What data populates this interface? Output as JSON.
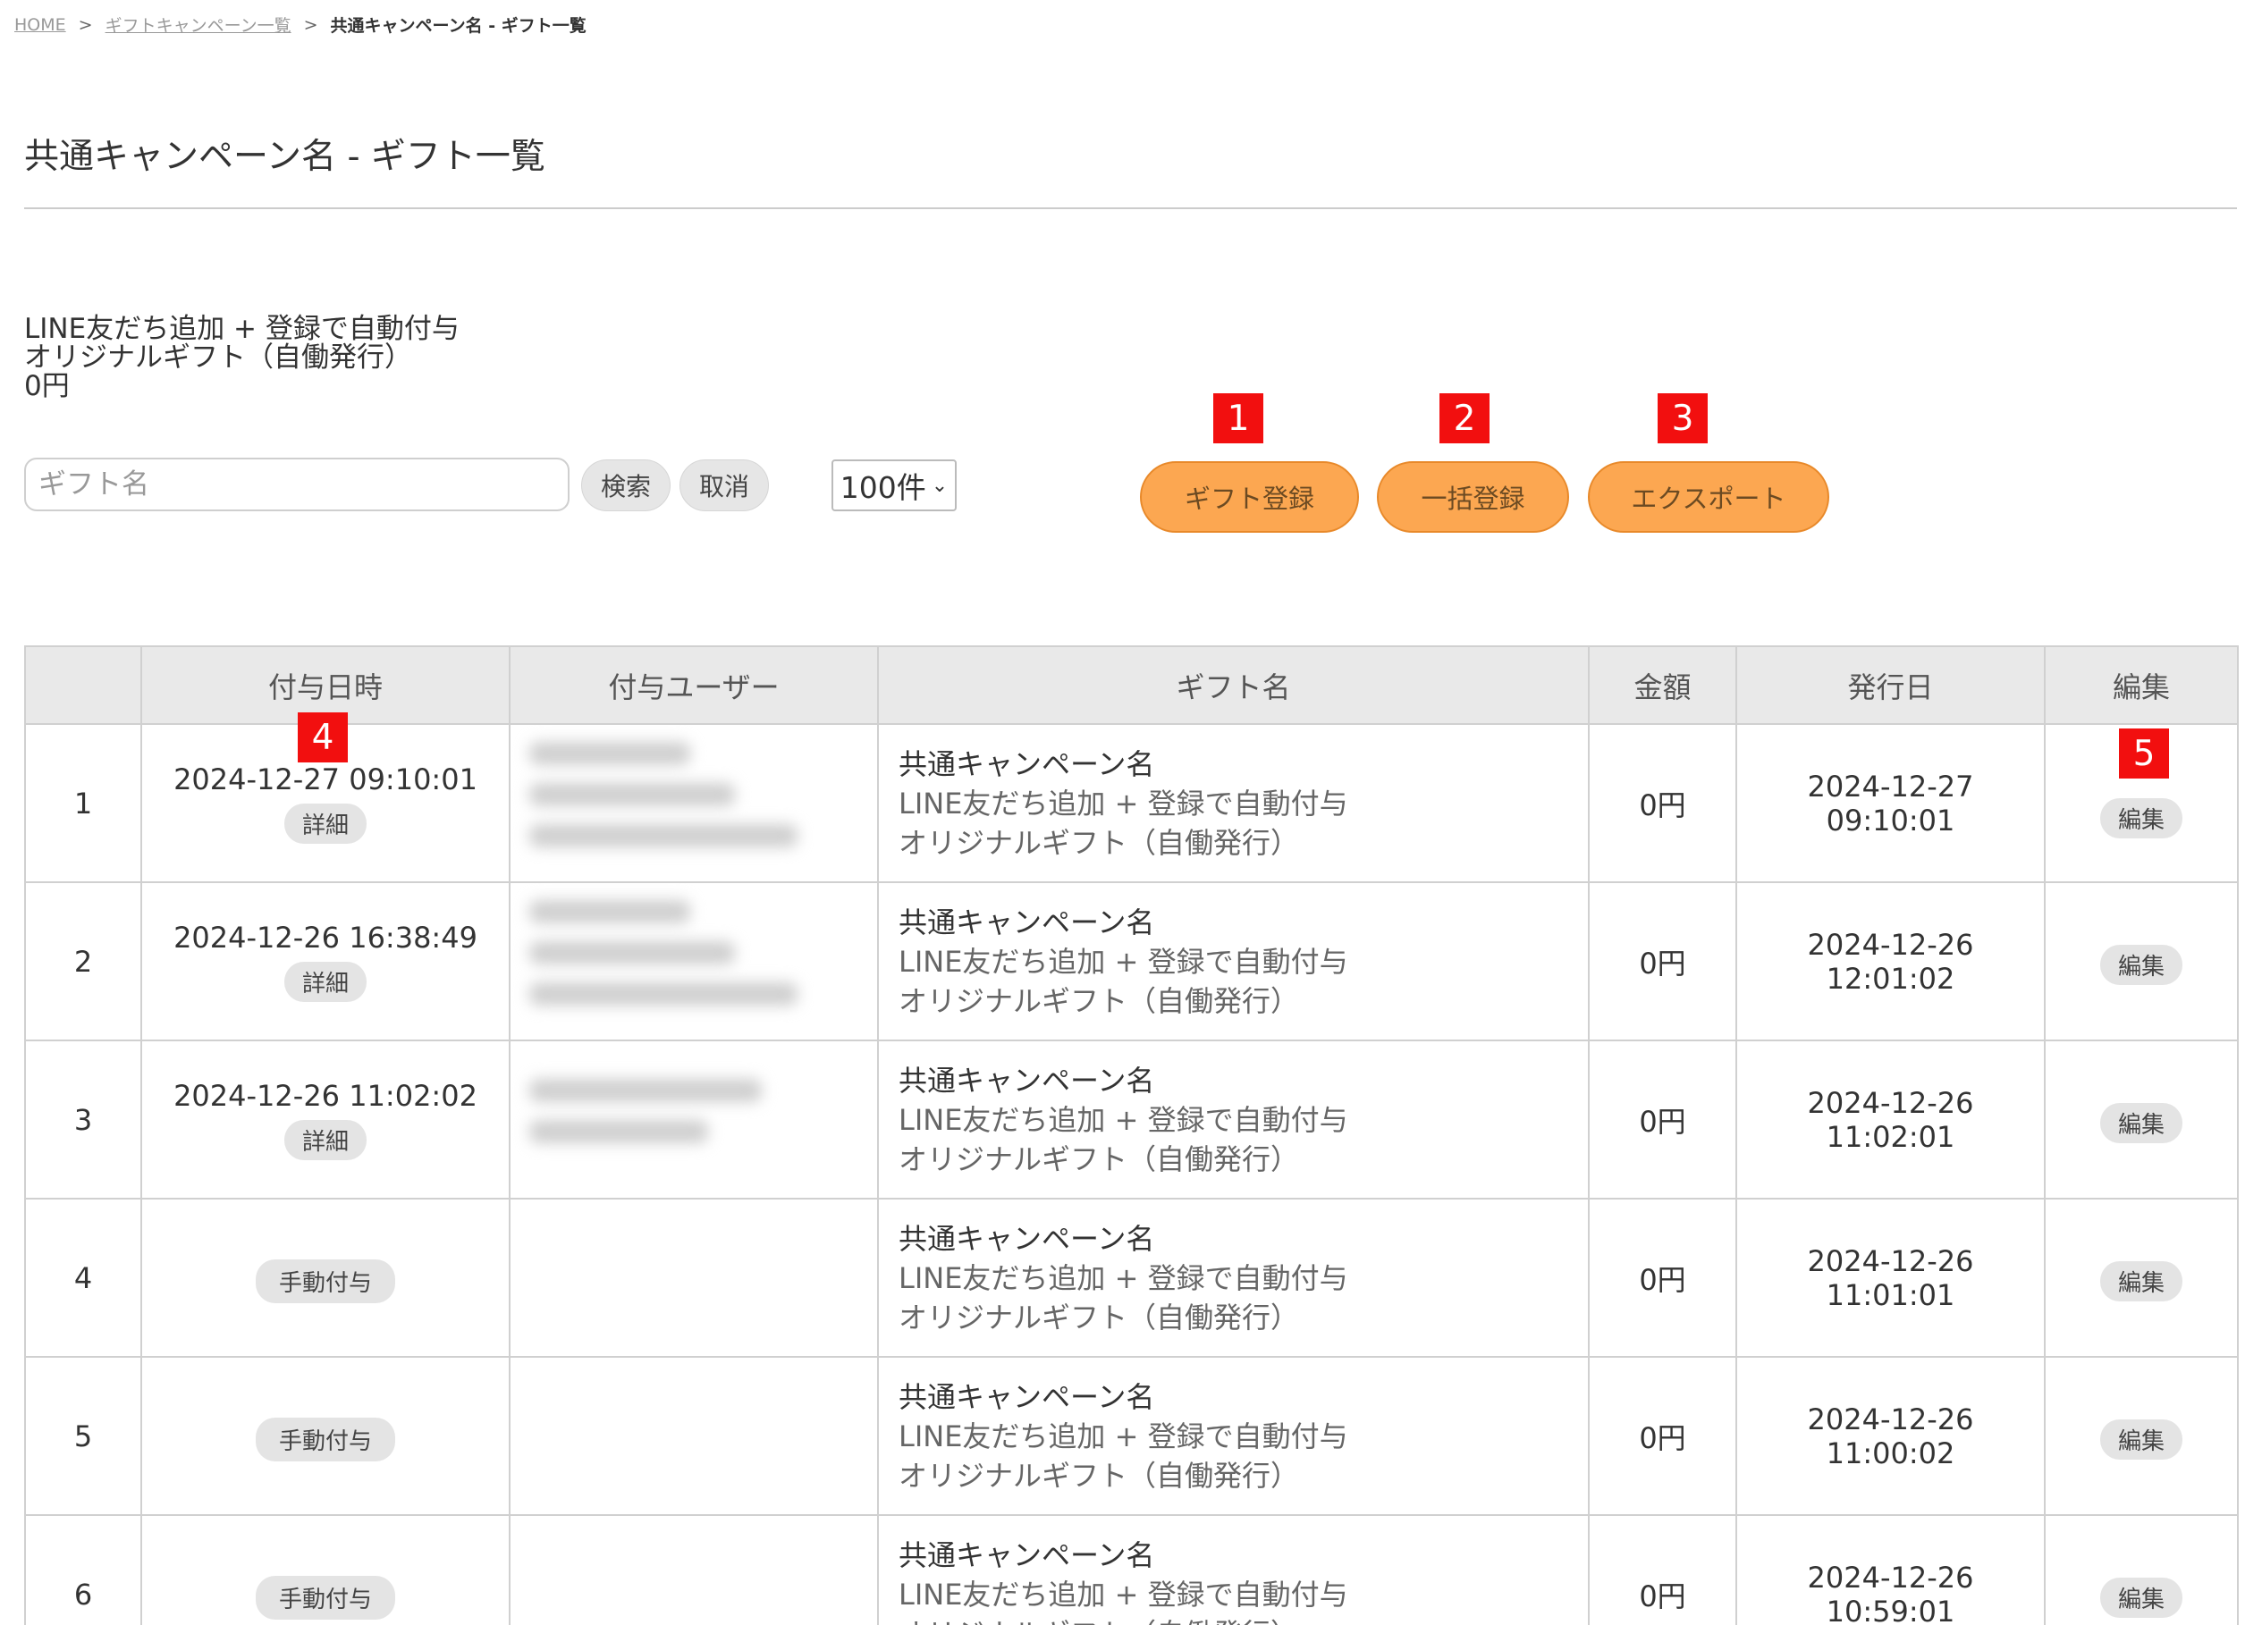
{
  "breadcrumb": {
    "home": "HOME",
    "campaign_list": "ギフトキャンペーン一覧",
    "current": "共通キャンペーン名 - ギフト一覧",
    "sep": ">"
  },
  "page_title": "共通キャンペーン名 - ギフト一覧",
  "campaign_info": {
    "line1": "LINE友だち追加 + 登録で自動付与",
    "line2": "オリジナルギフト（自働発行）",
    "line3": "0円"
  },
  "search": {
    "placeholder": "ギフト名",
    "search_label": "検索",
    "cancel_label": "取消",
    "per_page": "100件"
  },
  "actions": {
    "gift_register": "ギフト登録",
    "bulk_register": "一括登録",
    "export": "エクスポート"
  },
  "badges": [
    "1",
    "2",
    "3",
    "4",
    "5"
  ],
  "table": {
    "headers": [
      "",
      "付与日時",
      "付与ユーザー",
      "ギフト名",
      "金額",
      "発行日",
      "編集"
    ],
    "detail_label": "詳細",
    "manual_label": "手動付与",
    "edit_label": "編集",
    "rows": [
      {
        "no": "1",
        "grant_time": "2024-12-27 09:10:01",
        "grant_type": "detail",
        "gift_title": "共通キャンペーン名",
        "gift_sub1": "LINE友だち追加 + 登録で自動付与",
        "gift_sub2": "オリジナルギフト（自働発行）",
        "amount": "0円",
        "issue_date": "2024-12-27",
        "issue_time": "09:10:01"
      },
      {
        "no": "2",
        "grant_time": "2024-12-26 16:38:49",
        "grant_type": "detail",
        "gift_title": "共通キャンペーン名",
        "gift_sub1": "LINE友だち追加 + 登録で自動付与",
        "gift_sub2": "オリジナルギフト（自働発行）",
        "amount": "0円",
        "issue_date": "2024-12-26",
        "issue_time": "12:01:02"
      },
      {
        "no": "3",
        "grant_time": "2024-12-26 11:02:02",
        "grant_type": "detail",
        "gift_title": "共通キャンペーン名",
        "gift_sub1": "LINE友だち追加 + 登録で自動付与",
        "gift_sub2": "オリジナルギフト（自働発行）",
        "amount": "0円",
        "issue_date": "2024-12-26",
        "issue_time": "11:02:01"
      },
      {
        "no": "4",
        "grant_time": "",
        "grant_type": "manual",
        "gift_title": "共通キャンペーン名",
        "gift_sub1": "LINE友だち追加 + 登録で自動付与",
        "gift_sub2": "オリジナルギフト（自働発行）",
        "amount": "0円",
        "issue_date": "2024-12-26",
        "issue_time": "11:01:01"
      },
      {
        "no": "5",
        "grant_time": "",
        "grant_type": "manual",
        "gift_title": "共通キャンペーン名",
        "gift_sub1": "LINE友だち追加 + 登録で自動付与",
        "gift_sub2": "オリジナルギフト（自働発行）",
        "amount": "0円",
        "issue_date": "2024-12-26",
        "issue_time": "11:00:02"
      },
      {
        "no": "6",
        "grant_time": "",
        "grant_type": "manual",
        "gift_title": "共通キャンペーン名",
        "gift_sub1": "LINE友だち追加 + 登録で自動付与",
        "gift_sub2": "オリジナルギフト（自働発行）",
        "amount": "0円",
        "issue_date": "2024-12-26",
        "issue_time": "10:59:01"
      }
    ]
  },
  "colors": {
    "accent_orange": "#fca751",
    "badge_red": "#f20f0f",
    "header_gray": "#e9e9e9"
  }
}
